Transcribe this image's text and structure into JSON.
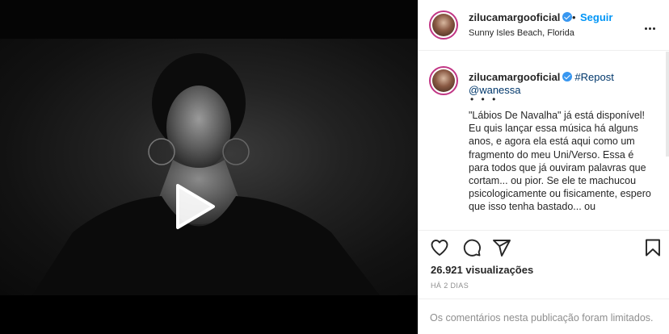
{
  "post": {
    "username": "zilucamargooficial",
    "follow_separator": "•",
    "follow_label": "Seguir",
    "location": "Sunny Isles Beach, Florida",
    "caption_tag": "#Repost",
    "caption_mention": "@wanessa",
    "caption_bullets": "• • •",
    "caption_text": "\"Lábios De Navalha\" já está disponível! Eu quis lançar essa música há alguns anos, e agora ela está aqui como um fragmento do meu Uni/Verso. Essa é para todos que já ouviram palavras que cortam... ou pior. Se ele te machucou psicologicamente ou fisicamente, espero que isso tenha bastado... ou",
    "views": "26.921 visualizações",
    "time": "HÁ 2 DIAS",
    "comments_limited": "Os comentários nesta publicação foram limitados."
  },
  "icons": {
    "play": "play-icon",
    "verified": "verified-badge-icon",
    "more": "more-options-icon",
    "like": "heart-icon",
    "comment": "comment-icon",
    "share": "share-icon",
    "save": "bookmark-icon"
  },
  "colors": {
    "link_blue": "#0095f6",
    "tag_blue": "#00376b",
    "muted": "#8e8e8e",
    "verified": "#3897f0"
  }
}
